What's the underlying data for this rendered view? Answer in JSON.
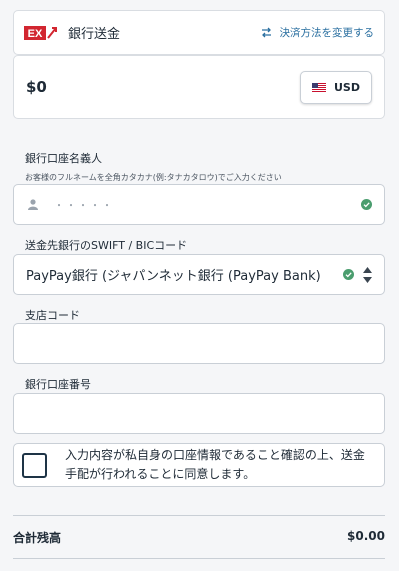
{
  "header": {
    "logo_text": "EX",
    "title": "銀行送金",
    "change_link": "決済方法を変更する"
  },
  "amount": {
    "value": "$0",
    "currency": "USD"
  },
  "account_name": {
    "label": "銀行口座名義人",
    "hint": "お客様のフルネームを全角カタカナ(例:タナカタロウ)でご入力ください",
    "value": "・・・・・"
  },
  "swift": {
    "label": "送金先銀行のSWIFT / BICコード",
    "value": "PayPay銀行 (ジャパンネット銀行 (PayPay Bank)"
  },
  "branch": {
    "label": "支店コード",
    "value": ""
  },
  "account_number": {
    "label": "銀行口座番号",
    "value": ""
  },
  "consent": {
    "text": "入力内容が私自身の口座情報であること確認の上、送金手配が行われることに同意します。"
  },
  "total": {
    "label": "合計残高",
    "value": "$0.00"
  },
  "colors": {
    "accent": "#2a6fa0",
    "valid": "#4a9d6e",
    "logo_red": "#d22630"
  }
}
